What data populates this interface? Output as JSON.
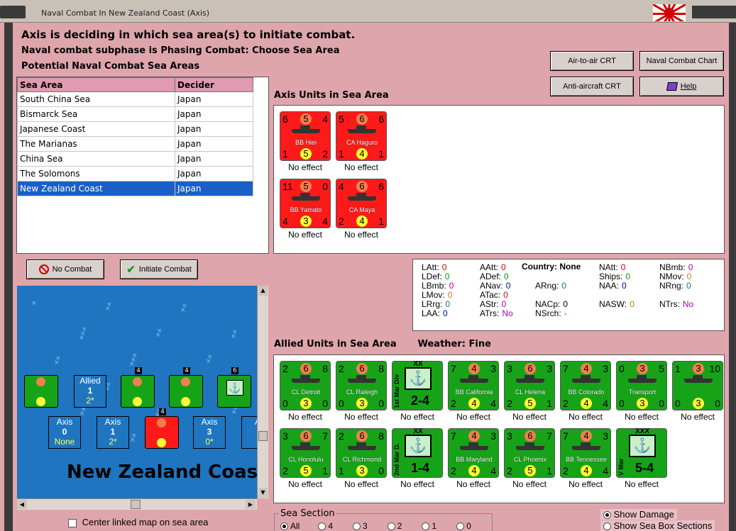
{
  "window": {
    "title": "Naval Combat In New Zealand Coast (Axis)"
  },
  "header": {
    "line1": "Axis is deciding in which sea area(s) to initiate combat.",
    "line2": "Naval combat subphase is Phasing Combat: Choose Sea Area",
    "line3": "Potential Naval Combat Sea Areas"
  },
  "buttons": {
    "air_crt": "Air-to-air CRT",
    "naval_chart": "Naval Combat Chart",
    "aa_crt": "Anti-aircraft CRT",
    "help": "Help",
    "no_combat": "No Combat",
    "initiate": "Initiate Combat"
  },
  "sea_table": {
    "columns": [
      "Sea Area",
      "Decider"
    ],
    "rows": [
      [
        "South China Sea",
        "Japan"
      ],
      [
        "Bismarck Sea",
        "Japan"
      ],
      [
        "Japanese Coast",
        "Japan"
      ],
      [
        "The Marianas",
        "Japan"
      ],
      [
        "China Sea",
        "Japan"
      ],
      [
        "The Solomons",
        "Japan"
      ],
      [
        "New Zealand Coast",
        "Japan"
      ]
    ],
    "selected_index": 6
  },
  "axis_units": {
    "label": "Axis Units in Sea Area",
    "units": [
      {
        "name": "BB Hiei",
        "tl": "6",
        "tc": "5",
        "tr": "4",
        "bl": "1",
        "bc": "5",
        "br": "2",
        "effect": "No effect"
      },
      {
        "name": "CA Haguro",
        "tl": "5",
        "tc": "6",
        "tr": "6",
        "bl": "1",
        "bc": "4",
        "br": "1",
        "effect": "No effect"
      },
      {
        "name": "BB Yamato",
        "tl": "11",
        "tc": "5",
        "tr": "0",
        "bl": "4",
        "bc": "3",
        "br": "4",
        "effect": "No effect"
      },
      {
        "name": "CA Maya",
        "tl": "4",
        "tc": "6",
        "tr": "6",
        "bl": "2",
        "bc": "4",
        "br": "1",
        "effect": "No effect"
      }
    ]
  },
  "stats": {
    "country_label": "Country:",
    "country": "None",
    "items": [
      {
        "k": "LAtt:",
        "v": "0",
        "c": "#d00000"
      },
      {
        "k": "LDef:",
        "v": "0",
        "c": "#00a000"
      },
      {
        "k": "LBmb:",
        "v": "0",
        "c": "#b000b0"
      },
      {
        "k": "LMov:",
        "v": "0",
        "c": "#c08000"
      },
      {
        "k": "LRrg:",
        "v": "0",
        "c": "#008080"
      },
      {
        "k": "LAA:",
        "v": "0",
        "c": "#0000c0"
      },
      {
        "k": "AAtt:",
        "v": "0",
        "c": "#d00000"
      },
      {
        "k": "ADef:",
        "v": "0",
        "c": "#00a000"
      },
      {
        "k": "ANav:",
        "v": "0",
        "c": "#0000c0"
      },
      {
        "k": "ATac:",
        "v": "0",
        "c": "#d00000"
      },
      {
        "k": "AStr:",
        "v": "0",
        "c": "#b000b0"
      },
      {
        "k": "ATrs:",
        "v": "No",
        "c": "#b000b0"
      },
      {
        "k": "ARng:",
        "v": "0",
        "c": "#008080"
      },
      {
        "k": "NACp:",
        "v": "0",
        "c": "#000000"
      },
      {
        "k": "NSrch:",
        "v": "-",
        "c": "#008080"
      },
      {
        "k": "NAtt:",
        "v": "0",
        "c": "#d00000"
      },
      {
        "k": "Ships:",
        "v": "0",
        "c": "#00a000"
      },
      {
        "k": "NAA:",
        "v": "0",
        "c": "#0000c0"
      },
      {
        "k": "NASW:",
        "v": "0",
        "c": "#c08000"
      },
      {
        "k": "NBmb:",
        "v": "0",
        "c": "#b000b0"
      },
      {
        "k": "NMov:",
        "v": "0",
        "c": "#c08000"
      },
      {
        "k": "NRng:",
        "v": "0",
        "c": "#008080"
      },
      {
        "k": "NTrs:",
        "v": "No",
        "c": "#b000b0"
      }
    ]
  },
  "allied": {
    "label": "Allied Units in Sea Area",
    "weather_label": "Weather:",
    "weather": "Fine",
    "units": [
      {
        "name": "CL Detroit",
        "tl": "2",
        "tc": "6",
        "tr": "8",
        "bl": "0",
        "bc": "3",
        "br": "0",
        "effect": "No effect"
      },
      {
        "name": "CL Raleigh",
        "tl": "2",
        "tc": "6",
        "tr": "8",
        "bl": "0",
        "bc": "3",
        "br": "0",
        "effect": "No effect"
      },
      {
        "name": "1st Mar Div",
        "marine": true,
        "xx": "XX",
        "value": "2-4",
        "effect": "No effect"
      },
      {
        "name": "BB California",
        "tl": "7",
        "tc": "4",
        "tr": "3",
        "bl": "2",
        "bc": "4",
        "br": "4",
        "effect": "No effect"
      },
      {
        "name": "CL Helena",
        "tl": "3",
        "tc": "6",
        "tr": "3",
        "bl": "2",
        "bc": "5",
        "br": "1",
        "effect": "No effect"
      },
      {
        "name": "BB Colorado",
        "tl": "7",
        "tc": "4",
        "tr": "3",
        "bl": "2",
        "bc": "4",
        "br": "4",
        "effect": "No effect"
      },
      {
        "name": "Transport",
        "tl": "0",
        "tc": "3",
        "tr": "5",
        "bl": "0",
        "bc": "3",
        "br": "0",
        "effect": "No effect"
      },
      {
        "name": "",
        "tl": "1",
        "tc": "3",
        "tr": "10",
        "bl": "0",
        "bc": "3",
        "br": "0",
        "effect": "No effect"
      },
      {
        "name": "CL Honolulu",
        "tl": "3",
        "tc": "6",
        "tr": "7",
        "bl": "2",
        "bc": "5",
        "br": "1",
        "effect": "No effect"
      },
      {
        "name": "CL Richmond",
        "tl": "2",
        "tc": "6",
        "tr": "8",
        "bl": "1",
        "bc": "3",
        "br": "0",
        "effect": "No effect"
      },
      {
        "name": "2nd Mar D.",
        "marine": true,
        "xx": "XX",
        "value": "1-4",
        "effect": "No effect"
      },
      {
        "name": "BB Maryland",
        "tl": "7",
        "tc": "4",
        "tr": "3",
        "bl": "2",
        "bc": "4",
        "br": "4",
        "effect": "No effect"
      },
      {
        "name": "CL Phoenix",
        "tl": "3",
        "tc": "6",
        "tr": "7",
        "bl": "2",
        "bc": "5",
        "br": "1",
        "effect": "No effect"
      },
      {
        "name": "BB Tennessee",
        "tl": "7",
        "tc": "4",
        "tr": "3",
        "bl": "2",
        "bc": "4",
        "br": "4",
        "effect": "No effect"
      },
      {
        "name": "V Mar",
        "marine": true,
        "xx": "XXX",
        "value": "5-4",
        "effect": "No effect"
      }
    ]
  },
  "map": {
    "label": "New Zealand Coast",
    "allied_chip": {
      "title": "Allied",
      "n": "1",
      "sub": "2*"
    },
    "axis_chips": [
      {
        "title": "Axis",
        "n": "0",
        "sub": "None"
      },
      {
        "title": "Axis",
        "n": "1",
        "sub": "2*"
      },
      {
        "title": "Axis",
        "n": "3",
        "sub": "0*"
      },
      {
        "title": "A"
      }
    ],
    "badges": [
      "4",
      "4",
      "6",
      "4"
    ]
  },
  "footer": {
    "center_map": "Center linked map on sea area",
    "sea_section": "Sea Section",
    "sections": [
      "All",
      "4",
      "3",
      "2",
      "1",
      "0"
    ],
    "show_damage": "Show Damage",
    "show_boxes": "Show Sea Box Sections"
  }
}
